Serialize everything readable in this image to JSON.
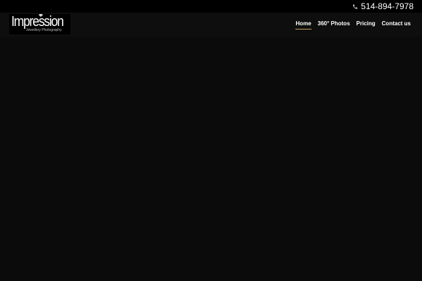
{
  "top_bar": {
    "phone_icon": "phone-icon",
    "phone_number": "514-894-7978"
  },
  "logo": {
    "title": "Impression",
    "tagline": "Jewellery Photography",
    "gem_icon": "diamond-icon"
  },
  "nav": {
    "items": [
      {
        "label": "Home",
        "active": true
      },
      {
        "label": "360° Photos",
        "active": false
      },
      {
        "label": "Pricing",
        "active": false
      },
      {
        "label": "Contact us",
        "active": false
      }
    ]
  },
  "colors": {
    "top_bar_bg": "#000000",
    "header_bg": "#0e0e0e",
    "page_bg": "#0b0b0b",
    "active_underline": "#c9a45a",
    "icon_color": "#e0e0e0"
  }
}
